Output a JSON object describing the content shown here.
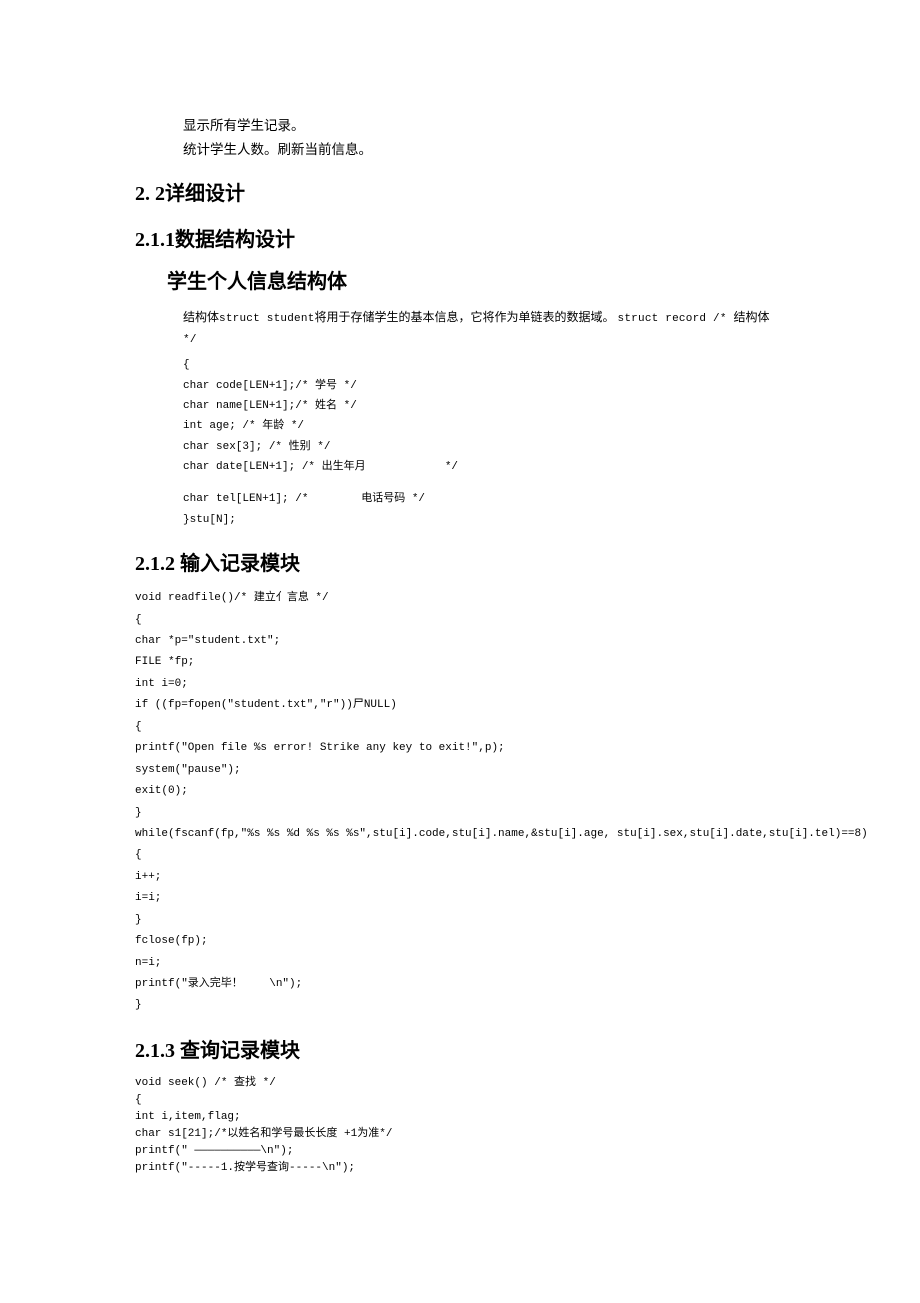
{
  "top": {
    "line1": "显示所有学生记录。",
    "line2": "统计学生人数。刷新当前信息。"
  },
  "headings": {
    "h22": "2.  2详细设计",
    "h211": "2.1.1数据结构设计",
    "struct_title": "学生个人信息结构体",
    "h212": "2.1.2 输入记录模块",
    "h213": "2.1.3 查询记录模块"
  },
  "struct_section": {
    "desc_prefix": "结构体",
    "desc_code1": "struct student",
    "desc_mid": "将用于存储学生的基本信息，它将作为单链表的数据域。 ",
    "desc_code2": "struct record /* ",
    "desc_suffix": "结构体",
    "desc_code3": " */",
    "lines": [
      "{",
      "char code[LEN+1];/* 学号 */",
      "char name[LEN+1];/* 姓名 */",
      "int age; /* 年龄 */",
      "char sex[3]; /* 性别 */",
      "char date[LEN+1]; /* 出生年月            */",
      "",
      "char tel[LEN+1]; /*        电话号码 */",
      "}stu[N];"
    ]
  },
  "readfile_code": "void readfile()/* 建立亻言息 */\n{\nchar *p=\"student.txt\";\nFILE *fp;\nint i=0;\nif ((fp=fopen(\"student.txt\",\"r\"))尸NULL)\n{\nprintf(\"Open file %s error! Strike any key to exit!\",p);\nsystem(\"pause\");\nexit(0);\n}\nwhile(fscanf(fp,\"%s %s %d %s %s %s\",stu[i].code,stu[i].name,&stu[i].age, stu[i].sex,stu[i].date,stu[i].tel)==8)\n{\ni++;\ni=i;\n}\nfclose(fp);\nn=i;\nprintf(\"录入完毕！    \\n\");\n}",
  "seek_code": "void seek() /* 查找 */\n{\nint i,item,flag;\nchar s1[21];/*以姓名和学号最长长度 +1为准*/\nprintf(\" ——————————\\n\");\nprintf(\"-----1.按学号查询-----\\n\");"
}
